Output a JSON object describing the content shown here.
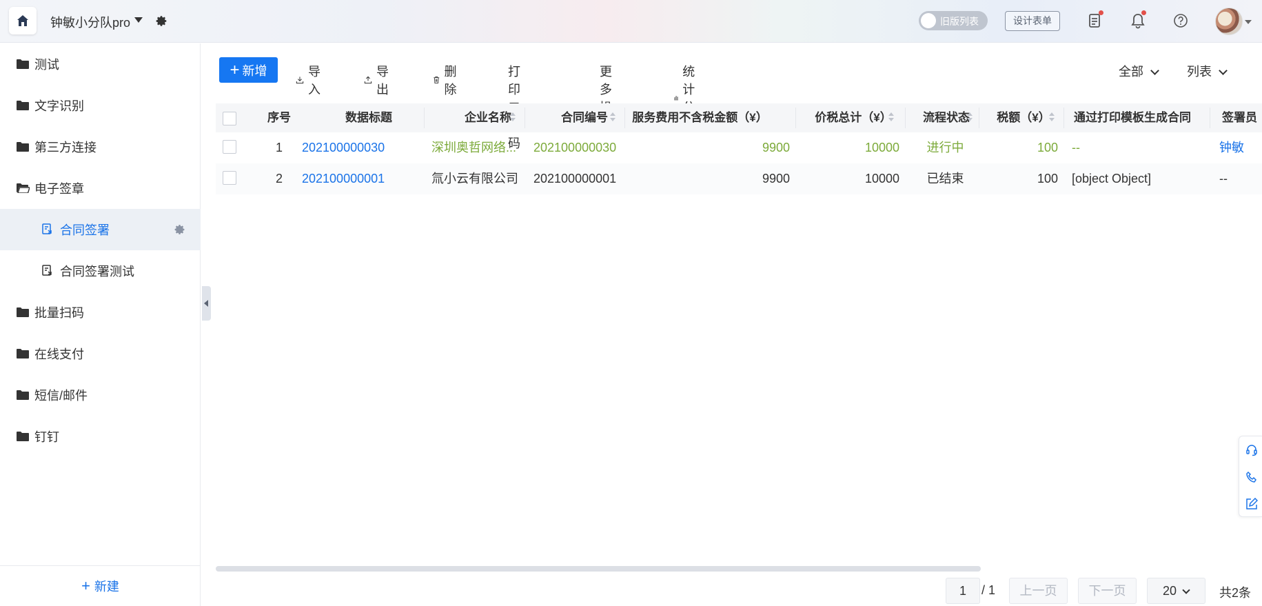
{
  "header": {
    "app_name": "钟敏小分队pro",
    "toggle_label": "旧版列表",
    "design_form": "设计表单"
  },
  "sidebar": {
    "items": [
      {
        "label": "测试",
        "type": "folder"
      },
      {
        "label": "文字识别",
        "type": "folder"
      },
      {
        "label": "第三方连接",
        "type": "folder"
      },
      {
        "label": "电子签章",
        "type": "folder-open"
      },
      {
        "label": "合同签署",
        "type": "form",
        "active": true
      },
      {
        "label": "合同签署测试",
        "type": "form"
      },
      {
        "label": "批量扫码",
        "type": "folder"
      },
      {
        "label": "在线支付",
        "type": "folder"
      },
      {
        "label": "短信/邮件",
        "type": "folder"
      },
      {
        "label": "钉钉",
        "type": "folder"
      }
    ],
    "new_label": "新建"
  },
  "toolbar": {
    "add": "新增",
    "import": "导入",
    "export": "导出",
    "delete": "删除",
    "print_qr": "打印二维码",
    "more": "更多操作",
    "stats": "统计分析",
    "filter": "全部",
    "view": "列表"
  },
  "table": {
    "columns": [
      "序号",
      "数据标题",
      "企业名称",
      "合同编号",
      "服务费用不含税金额（¥）",
      "价税总计（¥）",
      "流程状态",
      "税额（¥）",
      "通过打印模板生成合同",
      "签署员"
    ],
    "rows": [
      {
        "no": "1",
        "title": "202100000030",
        "company": "深圳奥哲网络...",
        "contract_no": "202100000030",
        "fee": "9900",
        "total": "10000",
        "status": "进行中",
        "tax": "100",
        "template": "--",
        "signer": "钟敏"
      },
      {
        "no": "2",
        "title": "202100000001",
        "company": "氚小云有限公司",
        "contract_no": "202100000001",
        "fee": "9900",
        "total": "10000",
        "status": "已结束",
        "tax": "100",
        "template": "[object Object]",
        "signer": "--"
      }
    ]
  },
  "pagination": {
    "current": "1",
    "total_pages": "/ 1",
    "prev": "上一页",
    "next": "下一页",
    "page_size": "20",
    "total": "共2条"
  },
  "colors": {
    "primary": "#1677f2",
    "link": "#1a73e8",
    "active_row_text": "#7caa3a",
    "sidebar_active_bg": "#ecf0f5"
  }
}
